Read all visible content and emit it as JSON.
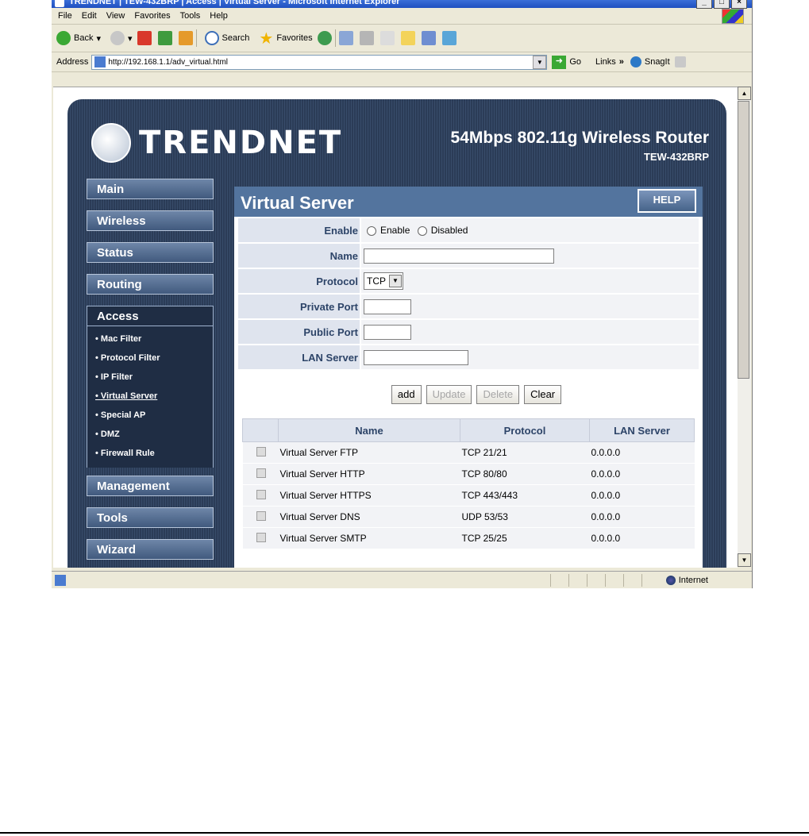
{
  "window": {
    "title": "TRENDNET | TEW-432BRP | Access | Virtual Server - Microsoft Internet Explorer",
    "controls": [
      "_",
      "□",
      "×"
    ]
  },
  "menu": [
    "File",
    "Edit",
    "View",
    "Favorites",
    "Tools",
    "Help"
  ],
  "toolbar": {
    "back": "Back",
    "search": "Search",
    "favorites": "Favorites"
  },
  "address": {
    "label": "Address",
    "url": "http://192.168.1.1/adv_virtual.html",
    "go": "Go",
    "links": "Links",
    "snagit": "SnagIt"
  },
  "router": {
    "brand": "TRENDNET",
    "product_line1": "54Mbps 802.11g Wireless Router",
    "product_line2": "TEW-432BRP"
  },
  "sidebar": {
    "main": "Main",
    "wireless": "Wireless",
    "status": "Status",
    "routing": "Routing",
    "access": "Access",
    "submenu": [
      "Mac Filter",
      "Protocol Filter",
      "IP Filter",
      "Virtual Server",
      "Special AP",
      "DMZ",
      "Firewall Rule"
    ],
    "management": "Management",
    "tools": "Tools",
    "wizard": "Wizard"
  },
  "content": {
    "title": "Virtual Server",
    "help": "HELP",
    "enable_label": "Enable",
    "enable_option": "Enable",
    "disabled_option": "Disabled",
    "name_label": "Name",
    "protocol_label": "Protocol",
    "protocol_value": "TCP",
    "private_port_label": "Private Port",
    "public_port_label": "Public Port",
    "lan_server_label": "LAN Server",
    "buttons": {
      "add": "add",
      "update": "Update",
      "delete": "Delete",
      "clear": "Clear"
    },
    "table_headers": {
      "name": "Name",
      "protocol": "Protocol",
      "lan_server": "LAN Server"
    },
    "rows": [
      {
        "name": "Virtual Server FTP",
        "protocol": "TCP 21/21",
        "lan": "0.0.0.0"
      },
      {
        "name": "Virtual Server HTTP",
        "protocol": "TCP 80/80",
        "lan": "0.0.0.0"
      },
      {
        "name": "Virtual Server HTTPS",
        "protocol": "TCP 443/443",
        "lan": "0.0.0.0"
      },
      {
        "name": "Virtual Server DNS",
        "protocol": "UDP 53/53",
        "lan": "0.0.0.0"
      },
      {
        "name": "Virtual Server SMTP",
        "protocol": "TCP 25/25",
        "lan": "0.0.0.0"
      }
    ]
  },
  "statusbar": {
    "zone": "Internet"
  }
}
